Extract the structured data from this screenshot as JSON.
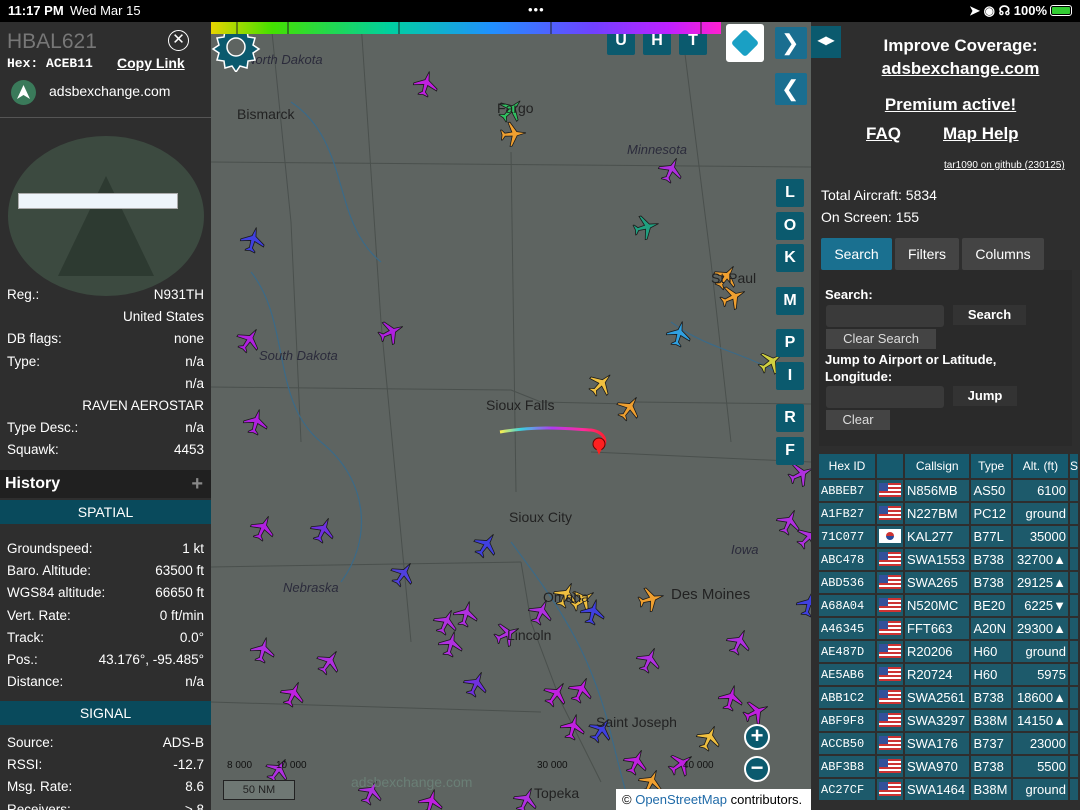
{
  "status_bar": {
    "time": "11:17 PM",
    "date": "Wed Mar 15",
    "battery": "100%",
    "battery_level": 1.0
  },
  "aircraft": {
    "callsign": "HBAL621",
    "hex_label": "Hex:",
    "hex": "ACEB11",
    "copy_link": "Copy Link",
    "site": "adsbexchange.com"
  },
  "details": [
    {
      "k": "Reg.:",
      "v": "N931TH"
    },
    {
      "k": "",
      "v": "United States"
    },
    {
      "k": "DB flags:",
      "v": "none"
    },
    {
      "k": "Type:",
      "v": "n/a"
    },
    {
      "k": "",
      "v": "n/a"
    },
    {
      "k": "",
      "v": "RAVEN AEROSTAR"
    },
    {
      "k": "Type Desc.:",
      "v": "n/a"
    },
    {
      "k": "Squawk:",
      "v": "4453"
    }
  ],
  "history_label": "History",
  "spatial_label": "SPATIAL",
  "spatial": [
    {
      "k": "Groundspeed:",
      "v": "1 kt"
    },
    {
      "k": "Baro. Altitude:",
      "v": "63500 ft"
    },
    {
      "k": "WGS84 altitude:",
      "v": "66650 ft"
    },
    {
      "k": "Vert. Rate:",
      "v": "0 ft/min"
    },
    {
      "k": "Track:",
      "v": "0.0°"
    },
    {
      "k": "Pos.:",
      "v": "43.176°, -95.485°"
    },
    {
      "k": "Distance:",
      "v": "n/a"
    }
  ],
  "signal_label": "SIGNAL",
  "signal": [
    {
      "k": "Source:",
      "v": "ADS-B"
    },
    {
      "k": "RSSI:",
      "v": "-12.7"
    },
    {
      "k": "Msg. Rate:",
      "v": "8.6"
    },
    {
      "k": "Receivers:",
      "v": "> 8"
    }
  ],
  "map": {
    "labels": {
      "north_dakota": "North Dakota",
      "bismarck": "Bismarck",
      "fargo": "Fargo",
      "minnesota": "Minnesota",
      "st_paul": "St Paul",
      "south_dakota": "South Dakota",
      "sioux_falls": "Sioux Falls",
      "sioux_city": "Sioux City",
      "iowa": "Iowa",
      "nebraska": "Nebraska",
      "des_moines": "Des Moines",
      "omaha": "Omaha",
      "lincoln": "Lincoln",
      "st_joseph": "Saint Joseph",
      "topeka": "Topeka"
    },
    "top_buttons": [
      "U",
      "H",
      "T"
    ],
    "side_buttons": [
      "L",
      "O",
      "K",
      "M",
      "P",
      "I",
      "R",
      "F"
    ],
    "scale_ticks": [
      "8 000",
      "10 000",
      "30 000",
      "40 000"
    ],
    "scale_unit": "50 NM",
    "zoom_in": "+",
    "zoom_out": "−",
    "watermark": "adsbexchange.com",
    "attribution_prefix": "©",
    "attribution_link": "OpenStreetMap",
    "attribution_suffix": "contributors."
  },
  "right": {
    "toggle": "◂▸",
    "improve": "Improve Coverage:",
    "improve_link": "adsbexchange.com",
    "premium": "Premium active!",
    "faq": "FAQ",
    "map_help": "Map Help",
    "tar": "tar1090 on github (230125)",
    "total": "Total Aircraft: 5834",
    "onscreen": "On Screen: 155",
    "tabs": [
      "Search",
      "Filters",
      "Columns"
    ],
    "search_label": "Search:",
    "search_btn": "Search",
    "clear_search": "Clear Search",
    "jump_label": "Jump to Airport or Latitude, Longitude:",
    "jump_btn": "Jump",
    "clear_btn": "Clear"
  },
  "table": {
    "headers": [
      "Hex ID",
      "",
      "Callsign",
      "Type",
      "Alt. (ft)",
      "S"
    ],
    "rows": [
      {
        "hex": "ABBEB7",
        "flag": "us",
        "callsign": "N856MB",
        "type": "AS50",
        "alt": "6100"
      },
      {
        "hex": "A1FB27",
        "flag": "us",
        "callsign": "N227BM",
        "type": "PC12",
        "alt": "ground"
      },
      {
        "hex": "71C077",
        "flag": "kr",
        "callsign": "KAL277",
        "type": "B77L",
        "alt": "35000"
      },
      {
        "hex": "ABC478",
        "flag": "us",
        "callsign": "SWA1553",
        "type": "B738",
        "alt": "32700▲"
      },
      {
        "hex": "ABD536",
        "flag": "us",
        "callsign": "SWA265",
        "type": "B738",
        "alt": "29125▲"
      },
      {
        "hex": "A68A04",
        "flag": "us",
        "callsign": "N520MC",
        "type": "BE20",
        "alt": "6225▼"
      },
      {
        "hex": "A46345",
        "flag": "us",
        "callsign": "FFT663",
        "type": "A20N",
        "alt": "29300▲"
      },
      {
        "hex": "AE487D",
        "flag": "us",
        "callsign": "R20206",
        "type": "H60",
        "alt": "ground"
      },
      {
        "hex": "AE5AB6",
        "flag": "us",
        "callsign": "R20724",
        "type": "H60",
        "alt": "5975"
      },
      {
        "hex": "ABB1C2",
        "flag": "us",
        "callsign": "SWA2561",
        "type": "B738",
        "alt": "18600▲"
      },
      {
        "hex": "ABF9F8",
        "flag": "us",
        "callsign": "SWA3297",
        "type": "B38M",
        "alt": "14150▲"
      },
      {
        "hex": "ACCB50",
        "flag": "us",
        "callsign": "SWA176",
        "type": "B737",
        "alt": "23000"
      },
      {
        "hex": "ABF3B8",
        "flag": "us",
        "callsign": "SWA970",
        "type": "B738",
        "alt": "5500"
      },
      {
        "hex": "AC27CF",
        "flag": "us",
        "callsign": "SWA1464",
        "type": "B38M",
        "alt": "ground"
      }
    ]
  },
  "colors": {
    "accent": "#0b5a6e",
    "panel": "#2e2e2e",
    "map": "#5e6461"
  }
}
